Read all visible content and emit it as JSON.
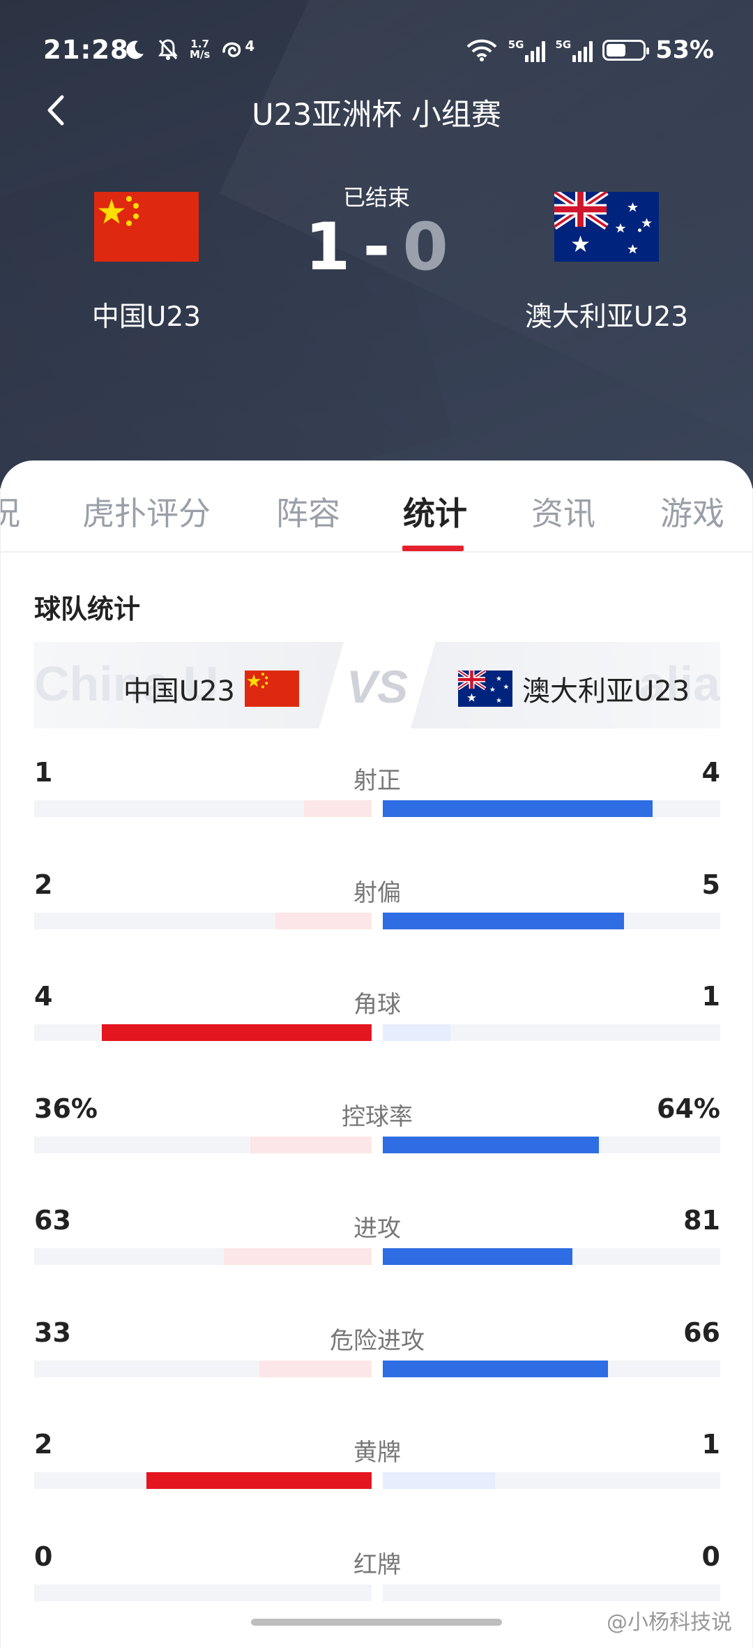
{
  "status_bar": {
    "time": "21:28",
    "net_speed_top": "1.7",
    "net_speed_bottom": "M/s",
    "badge": "4",
    "signal_label_1": "5G",
    "signal_label_2": "5G",
    "battery": "53%",
    "battery_level": 0.53
  },
  "nav": {
    "title": "U23亚洲杯 小组赛"
  },
  "match": {
    "status": "已结束",
    "home_team": "中国U23",
    "away_team": "澳大利亚U23",
    "home_score": "1",
    "away_score": "0",
    "separator": "-"
  },
  "tabs": [
    {
      "label": "况"
    },
    {
      "label": "虎扑评分"
    },
    {
      "label": "阵容"
    },
    {
      "label": "统计"
    },
    {
      "label": "资讯"
    },
    {
      "label": "游戏"
    }
  ],
  "active_tab": "统计",
  "section": {
    "title": "球队统计"
  },
  "comparison": {
    "home_team": "中国U23",
    "away_team": "澳大利亚U23",
    "vs": "VS",
    "watermark_left": "China U",
    "watermark_right": "alia"
  },
  "colors": {
    "home_highlight": "#e4161f",
    "home_light": "#fde6e7",
    "away_highlight": "#2e6de3",
    "away_light": "#e6edfc",
    "track": "#f3f4f7",
    "accent": "#e4222e"
  },
  "stats": [
    {
      "label": "射正",
      "home": "1",
      "away": "4",
      "home_ratio": 0.2,
      "away_ratio": 0.8,
      "leader": "away"
    },
    {
      "label": "射偏",
      "home": "2",
      "away": "5",
      "home_ratio": 0.286,
      "away_ratio": 0.714,
      "leader": "away"
    },
    {
      "label": "角球",
      "home": "4",
      "away": "1",
      "home_ratio": 0.8,
      "away_ratio": 0.2,
      "leader": "home"
    },
    {
      "label": "控球率",
      "home": "36%",
      "away": "64%",
      "home_ratio": 0.36,
      "away_ratio": 0.64,
      "leader": "away"
    },
    {
      "label": "进攻",
      "home": "63",
      "away": "81",
      "home_ratio": 0.4375,
      "away_ratio": 0.5625,
      "leader": "away"
    },
    {
      "label": "危险进攻",
      "home": "33",
      "away": "66",
      "home_ratio": 0.333,
      "away_ratio": 0.667,
      "leader": "away"
    },
    {
      "label": "黄牌",
      "home": "2",
      "away": "1",
      "home_ratio": 0.667,
      "away_ratio": 0.333,
      "leader": "home"
    },
    {
      "label": "红牌",
      "home": "0",
      "away": "0",
      "home_ratio": 0,
      "away_ratio": 0,
      "leader": "none"
    }
  ],
  "footer": {
    "watermark": "@小杨科技说"
  }
}
